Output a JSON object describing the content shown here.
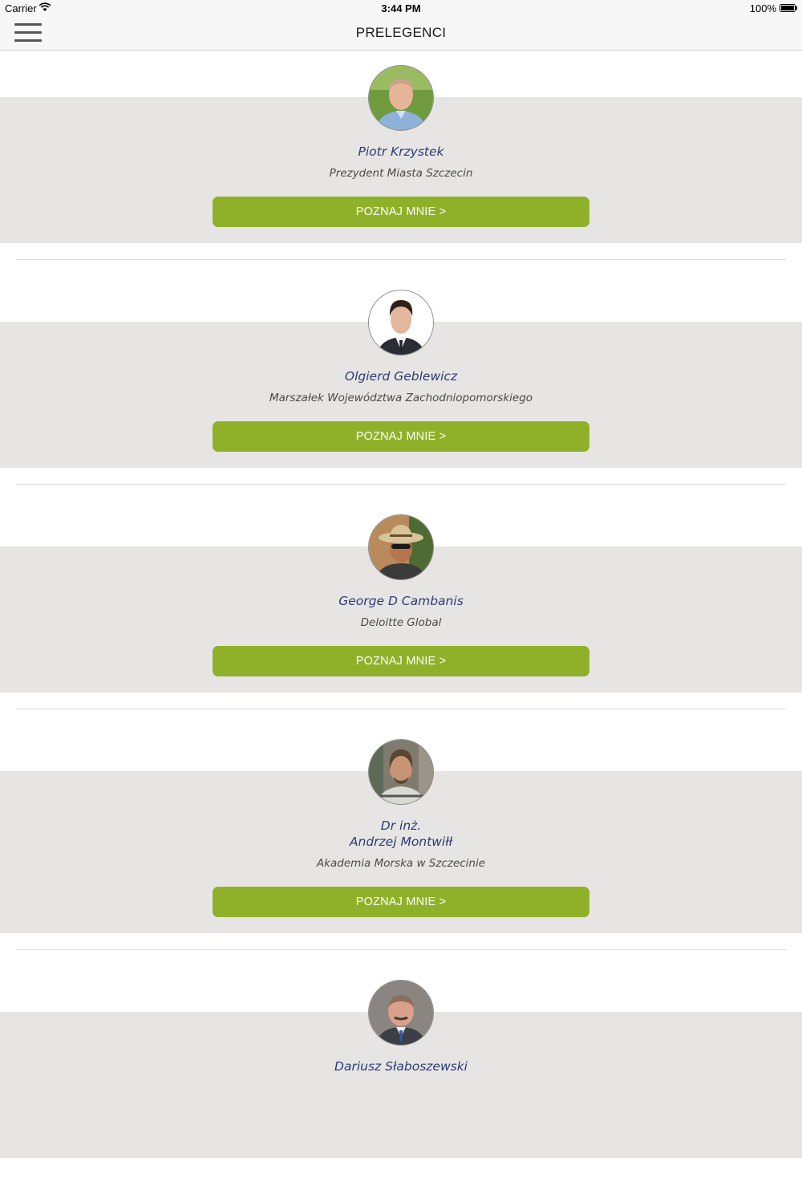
{
  "status_bar": {
    "carrier": "Carrier",
    "time": "3:44 PM",
    "battery": "100%"
  },
  "nav": {
    "title": "PRELEGENCI"
  },
  "speakers": [
    {
      "name": "Piotr Krzystek",
      "role": "Prezydent Miasta Szczecin",
      "button": "POZNAJ MNIE >"
    },
    {
      "name": "Olgierd Geblewicz",
      "role": "Marszałek Województwa Zachodniopomorskiego",
      "button": "POZNAJ MNIE >"
    },
    {
      "name": "George D Cambanis",
      "role": "Deloitte Global",
      "button": "POZNAJ MNIE >"
    },
    {
      "name": "Dr inż.\nAndrzej Montwiłł",
      "role": "Akademia Morska w Szczecinie",
      "button": "POZNAJ MNIE >"
    },
    {
      "name": "Dariusz Słaboszewski",
      "role": "",
      "button": ""
    }
  ],
  "colors": {
    "button": "#8fb12a",
    "name_text": "#2b3a78",
    "band": "#e6e5e3"
  }
}
